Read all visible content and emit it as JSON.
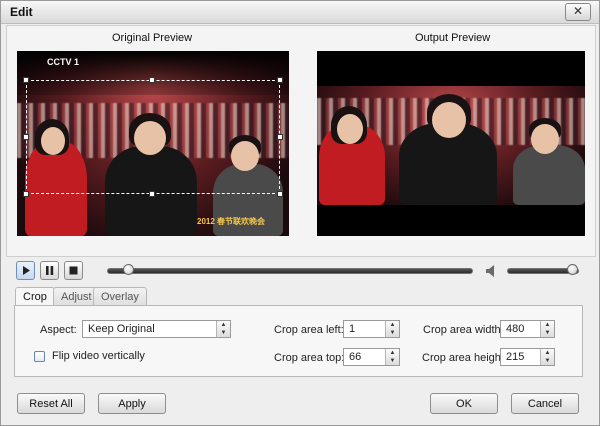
{
  "window": {
    "title": "Edit",
    "close_glyph": "✕"
  },
  "previews": {
    "original_label": "Original Preview",
    "output_label": "Output Preview",
    "channel_logo": "CCTV 1",
    "show_logo": "2012 春节联欢晚会"
  },
  "playback": {
    "play_icon": "play-icon",
    "pause_icon": "pause-icon",
    "stop_icon": "stop-icon",
    "progress": 0.0,
    "volume": 1.0
  },
  "tabs": [
    {
      "label": "Crop",
      "active": true
    },
    {
      "label": "Adjust",
      "active": false
    },
    {
      "label": "Overlay",
      "active": false
    }
  ],
  "crop": {
    "aspect_label": "Aspect:",
    "aspect_value": "Keep Original",
    "flip_label": "Flip video vertically",
    "flip_checked": false,
    "left_label": "Crop area left:",
    "left_value": "1",
    "top_label": "Crop area top:",
    "top_value": "66",
    "width_label": "Crop area width:",
    "width_value": "480",
    "height_label": "Crop area height:",
    "height_value": "215"
  },
  "buttons": {
    "reset_all": "Reset All",
    "apply": "Apply",
    "ok": "OK",
    "cancel": "Cancel"
  }
}
